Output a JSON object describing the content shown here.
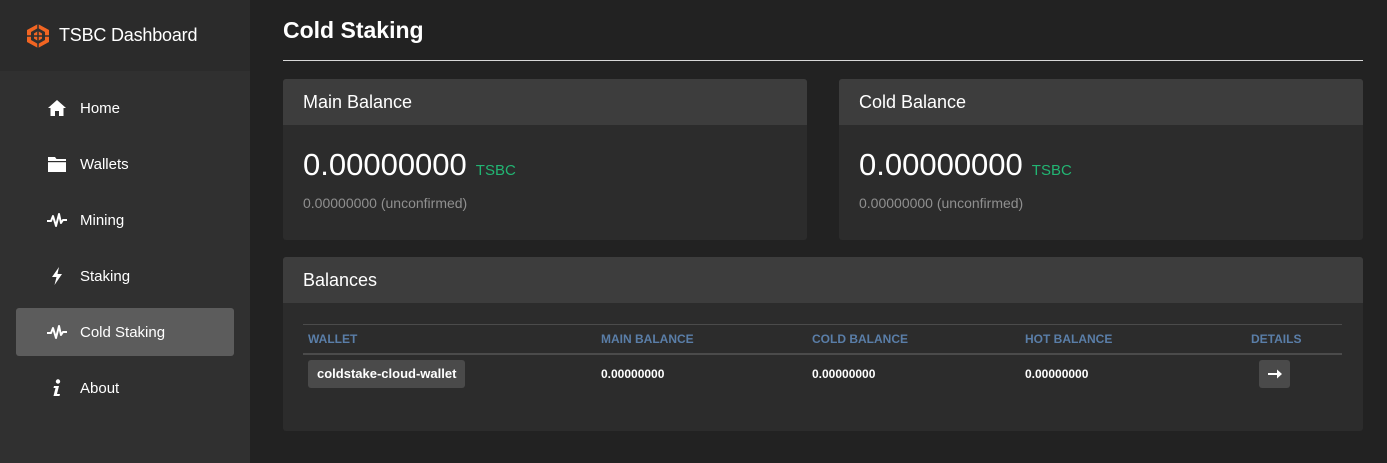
{
  "brand": {
    "title": "TSBC Dashboard",
    "logo_color": "#f26522"
  },
  "nav": [
    {
      "label": "Home",
      "icon": "home-icon",
      "active": false
    },
    {
      "label": "Wallets",
      "icon": "folder-icon",
      "active": false
    },
    {
      "label": "Mining",
      "icon": "pulse-icon",
      "active": false
    },
    {
      "label": "Staking",
      "icon": "bolt-icon",
      "active": false
    },
    {
      "label": "Cold Staking",
      "icon": "pulse-icon",
      "active": true
    },
    {
      "label": "About",
      "icon": "info-icon",
      "active": false
    }
  ],
  "page": {
    "title": "Cold Staking"
  },
  "main_balance": {
    "title": "Main Balance",
    "amount": "0.00000000",
    "unit": "TSBC",
    "unconfirmed": "0.00000000 (unconfirmed)"
  },
  "cold_balance": {
    "title": "Cold Balance",
    "amount": "0.00000000",
    "unit": "TSBC",
    "unconfirmed": "0.00000000 (unconfirmed)"
  },
  "balances": {
    "title": "Balances",
    "columns": [
      "WALLET",
      "MAIN BALANCE",
      "COLD BALANCE",
      "HOT BALANCE",
      "DETAILS"
    ],
    "rows": [
      {
        "wallet": "coldstake-cloud-wallet",
        "main": "0.00000000",
        "cold": "0.00000000",
        "hot": "0.00000000",
        "details_icon": "arrow-right-icon"
      }
    ]
  },
  "colors": {
    "accent_green": "#22b573",
    "header_blue": "#5a7ea8",
    "active_nav": "#5c5c5c"
  }
}
